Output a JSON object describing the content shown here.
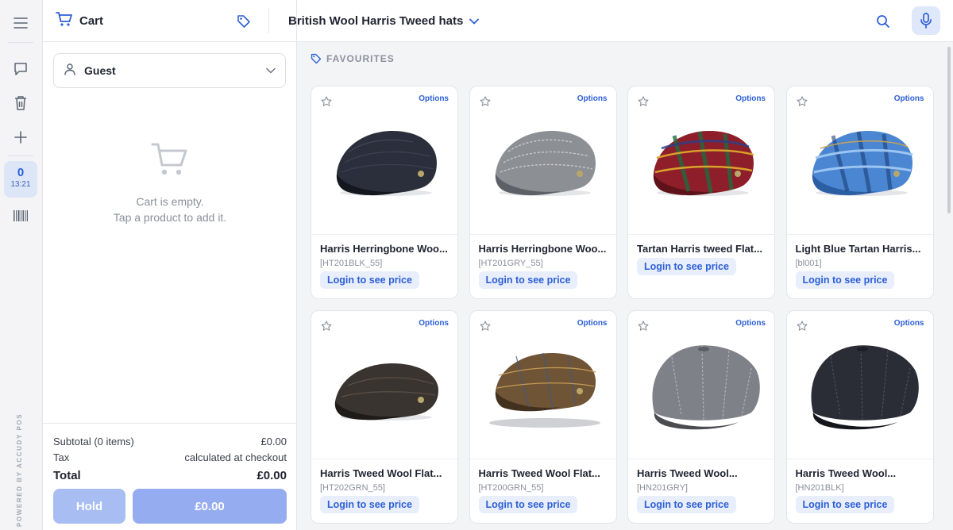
{
  "header": {
    "cart_title": "Cart",
    "category": "British Wool Harris Tweed hats"
  },
  "rail": {
    "items": [
      {
        "icon": "menu-icon"
      },
      {
        "icon": "chat-icon"
      },
      {
        "icon": "trash-icon"
      },
      {
        "icon": "plus-icon"
      },
      {
        "icon": "barcode-icon"
      }
    ],
    "counter": "0",
    "time": "13:21",
    "powered_by": "POWERED BY ACCUDY POS"
  },
  "cart": {
    "customer": "Guest",
    "empty_line1": "Cart is empty.",
    "empty_line2": "Tap a product to add it.",
    "subtotal_label": "Subtotal (0 items)",
    "subtotal_value": "£0.00",
    "tax_label": "Tax",
    "tax_value": "calculated at checkout",
    "total_label": "Total",
    "total_value": "£0.00",
    "hold_label": "Hold",
    "pay_label": "£0.00"
  },
  "products": {
    "section_label": "FAVOURITES",
    "items": [
      {
        "name": "Harris Herringbone Woo...",
        "sku": "[HT201BLK_55]",
        "price_label": "Login to see price",
        "options_label": "Options"
      },
      {
        "name": "Harris Herringbone Woo...",
        "sku": "[HT201GRY_55]",
        "price_label": "Login to see price",
        "options_label": "Options"
      },
      {
        "name": "Tartan Harris tweed Flat...",
        "sku": "",
        "price_label": "Login to see price",
        "options_label": "Options"
      },
      {
        "name": "Light Blue Tartan Harris...",
        "sku": "[bl001]",
        "price_label": "Login to see price",
        "options_label": "Options"
      },
      {
        "name": "Harris Tweed Wool Flat...",
        "sku": "[HT202GRN_55]",
        "price_label": "Login to see price",
        "options_label": "Options"
      },
      {
        "name": "Harris Tweed Wool Flat...",
        "sku": "[HT200GRN_55]",
        "price_label": "Login to see price",
        "options_label": "Options"
      },
      {
        "name": "Harris Tweed Wool...",
        "sku": "[HN201GRY]",
        "price_label": "Login to see price",
        "options_label": "Options"
      },
      {
        "name": "Harris Tweed Wool...",
        "sku": "[HN201BLK]",
        "price_label": "Login to see price",
        "options_label": "Options"
      }
    ]
  },
  "colors": {
    "accent": "#2d5fd6",
    "accent_light": "#e8eefb",
    "hold_button": "#a8bdf2",
    "pay_button": "#95acf0"
  }
}
